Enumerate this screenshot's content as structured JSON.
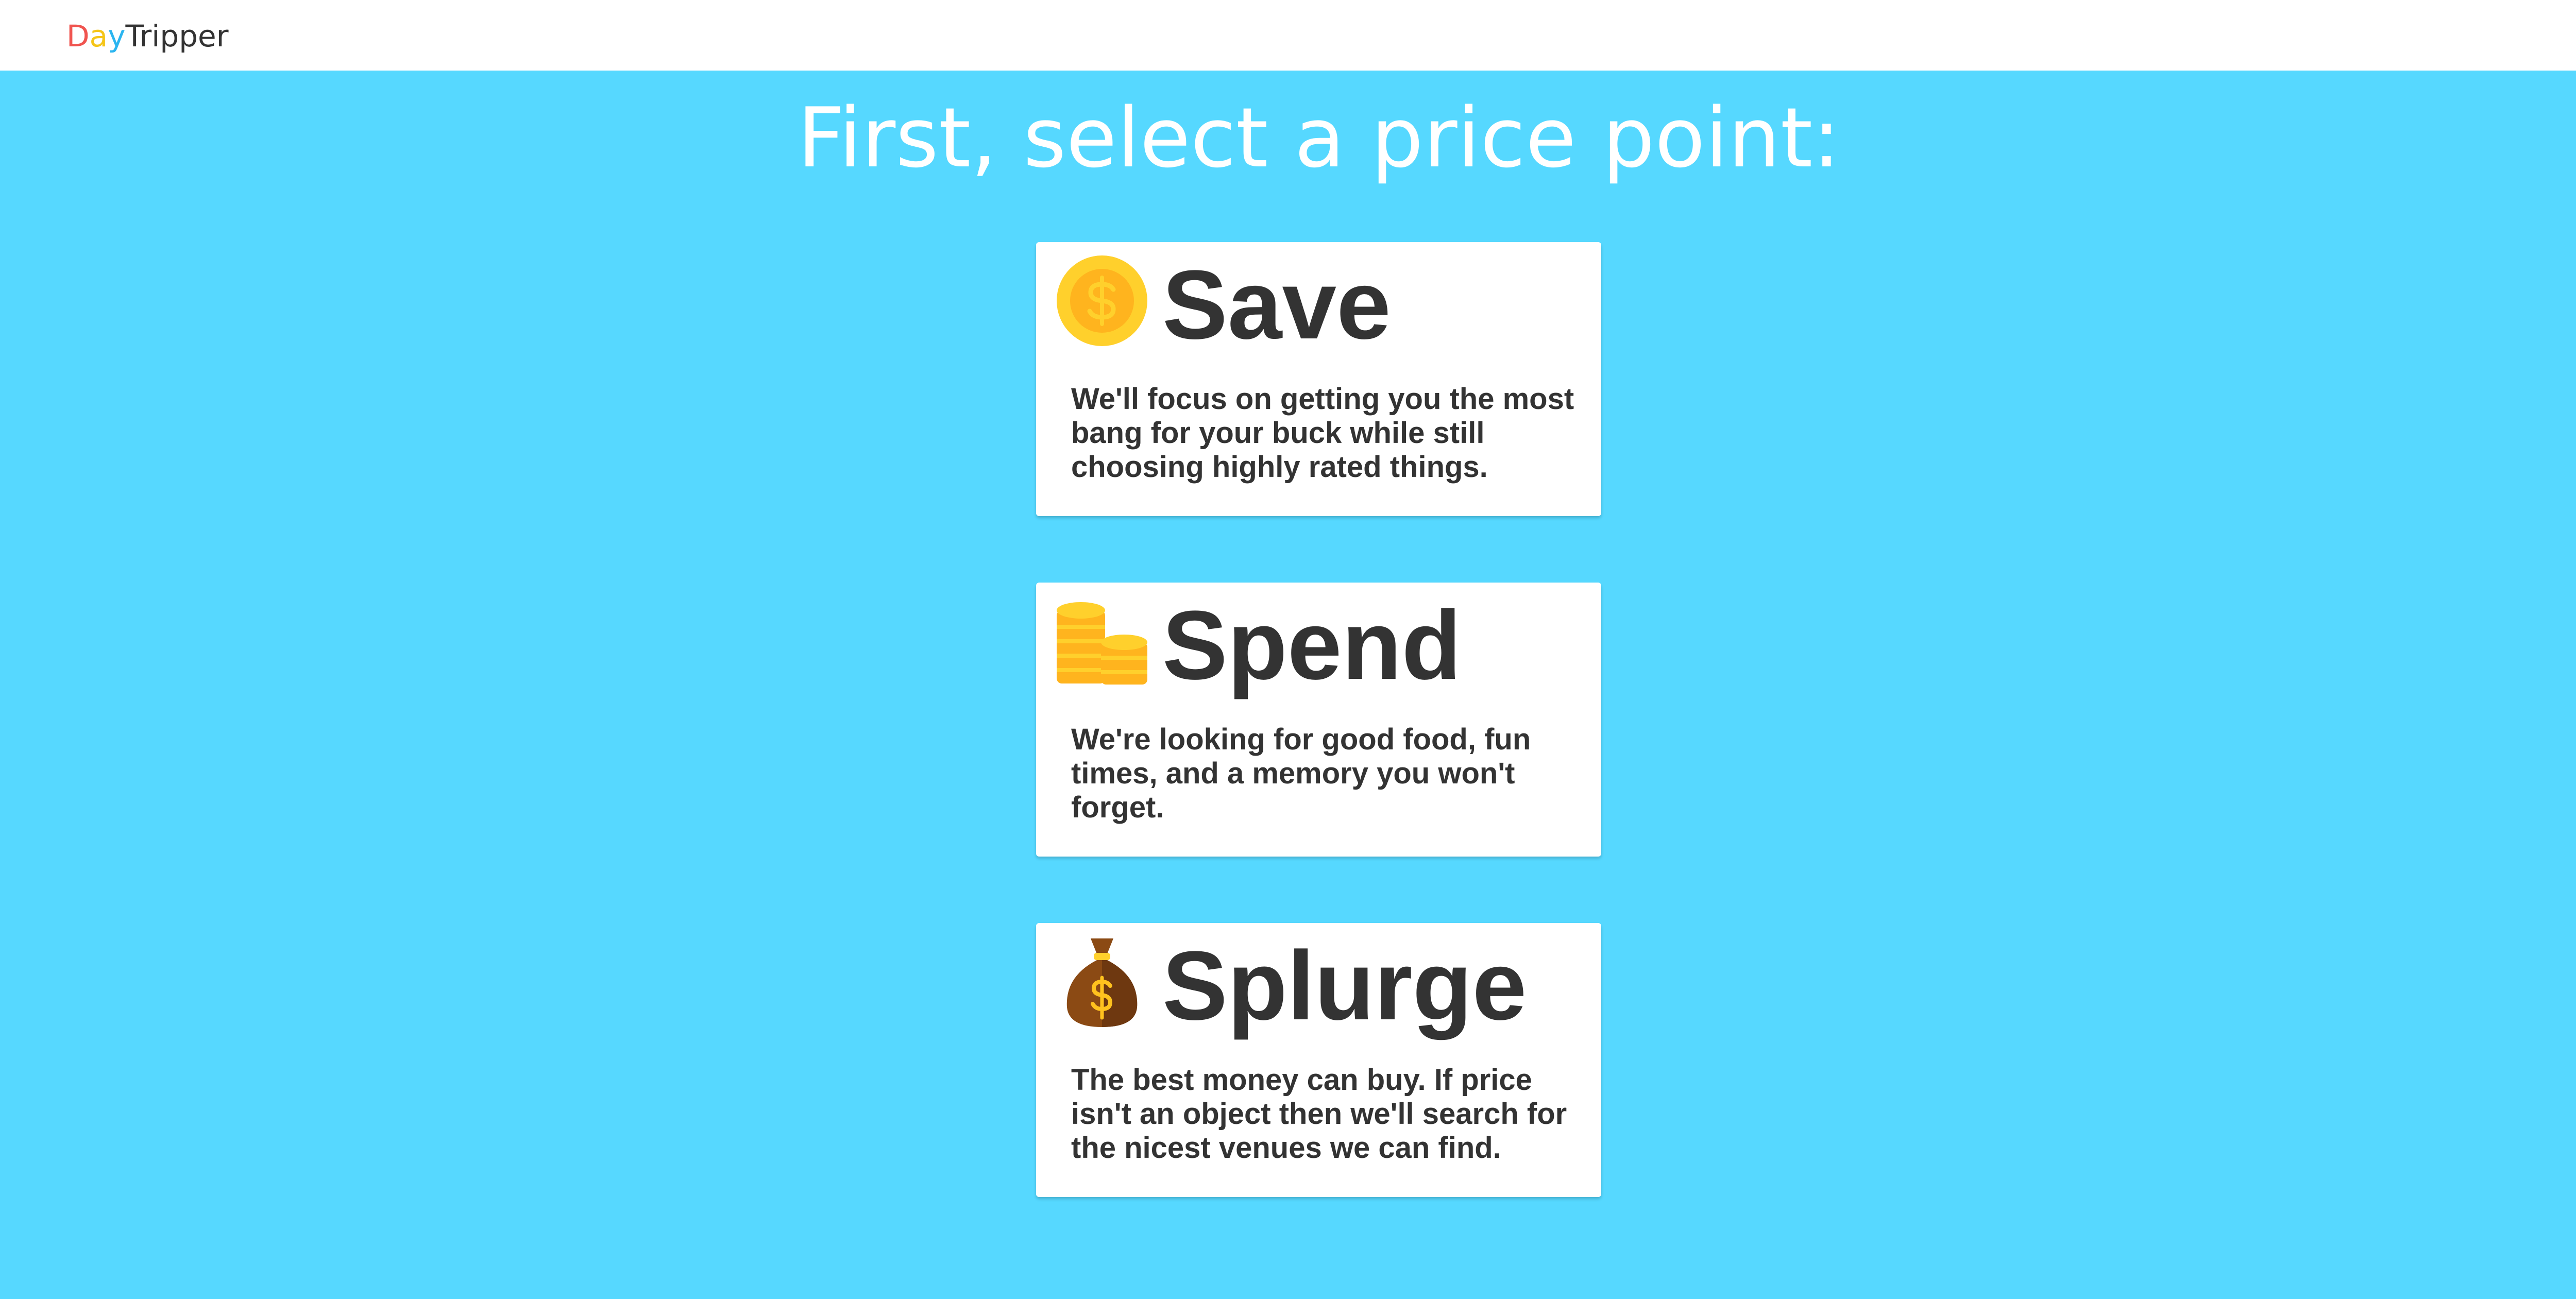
{
  "brand": {
    "letters": [
      {
        "char": "D",
        "color": "#f0544f"
      },
      {
        "char": "a",
        "color": "#f5c518"
      },
      {
        "char": "y",
        "color": "#2bb5f0"
      }
    ],
    "rest": "Tripper",
    "rest_color": "#333333"
  },
  "page": {
    "heading": "First, select a price point:",
    "background_color": "#56d8ff"
  },
  "options": [
    {
      "title": "Save",
      "icon": "coin-icon",
      "description": "We'll focus on getting you the most bang for your buck while still choosing highly rated things."
    },
    {
      "title": "Spend",
      "icon": "coin-stacks-icon",
      "description": "We're looking for good food, fun times, and a memory you won't forget."
    },
    {
      "title": "Splurge",
      "icon": "money-bag-icon",
      "description": "The best money can buy. If price isn't an object then we'll search for the nicest venues we can find."
    }
  ]
}
